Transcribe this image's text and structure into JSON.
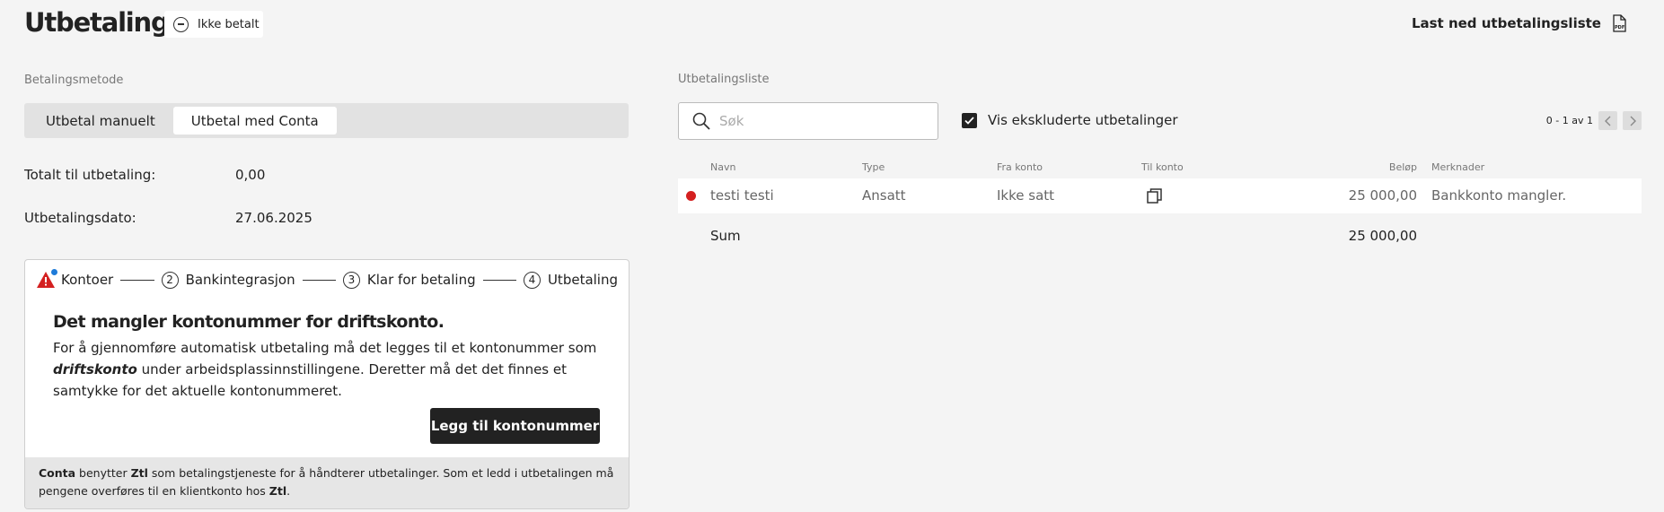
{
  "header": {
    "title": "Utbetalinger",
    "status": "Ikke betalt",
    "download_label": "Last ned utbetalingsliste",
    "download_icon": "pdf-icon"
  },
  "payment_method": {
    "label": "Betalingsmetode",
    "options": [
      "Utbetal manuelt",
      "Utbetal med Conta"
    ],
    "selected": "Utbetal med Conta"
  },
  "summary": {
    "total_label": "Totalt til utbetaling:",
    "total_value": "0,00",
    "date_label": "Utbetalingsdato:",
    "date_value": "27.06.2025"
  },
  "stepper": {
    "steps": [
      {
        "num": "",
        "label": "Kontoer",
        "state": "warning"
      },
      {
        "num": "2",
        "label": "Bankintegrasjon"
      },
      {
        "num": "3",
        "label": "Klar for betaling"
      },
      {
        "num": "4",
        "label": "Utbetaling"
      }
    ]
  },
  "notice": {
    "title": "Det mangler kontonummer for driftskonto.",
    "text_1": "For å gjennomføre automatisk utbetaling må det legges til et kontonummer som",
    "text_bold": "driftskonto",
    "text_2": " under arbeidsplassinnstillingene. Deretter må det det finnes et samtykke for det aktuelle kontonummeret.",
    "button": "Legg til kontonummer"
  },
  "footer_note": {
    "brand": "Conta",
    "part_1": " benytter ",
    "provider": "Ztl",
    "part_2": " som betalingstjeneste for å håndterer utbetalinger. Som et ledd i utbetalingen må pengene overføres til en klientkonto hos ",
    "provider_2": "Ztl",
    "part_3": "."
  },
  "list": {
    "label": "Utbetalingsliste",
    "search_placeholder": "Søk",
    "show_excluded": "Vis ekskluderte utbetalinger",
    "show_excluded_checked": true,
    "pagination": "0 - 1 av 1",
    "columns": [
      "Navn",
      "Type",
      "Fra konto",
      "Til konto",
      "Beløp",
      "Merknader"
    ],
    "rows": [
      {
        "name": "testi testi",
        "type": "Ansatt",
        "from": "Ikke satt",
        "to_icon": "copy-icon",
        "amount": "25 000,00",
        "note": "Bankkonto mangler.",
        "status_color": "#d42020"
      }
    ],
    "sum_label": "Sum",
    "sum_value": "25 000,00"
  }
}
